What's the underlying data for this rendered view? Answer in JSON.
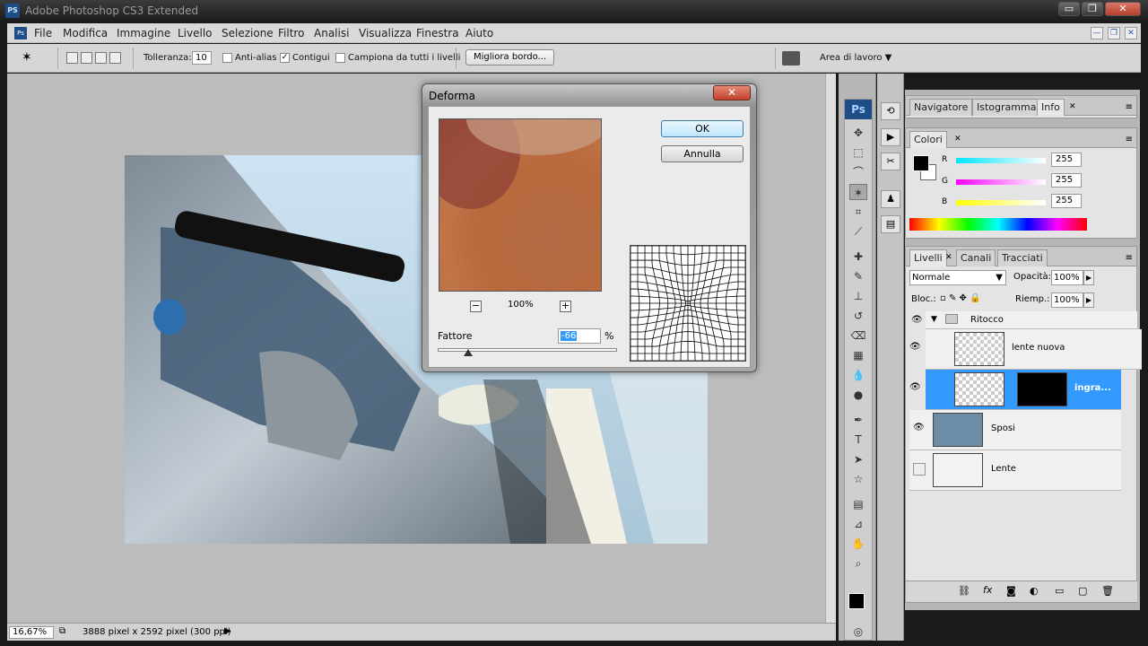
{
  "window": {
    "title": "Adobe Photoshop CS3 Extended",
    "app_badge": "Ps",
    "doc_badge": "PS",
    "window_controls": [
      "▭",
      "❐",
      "✕"
    ]
  },
  "menubar": {
    "items": [
      "File",
      "Modifica",
      "Immagine",
      "Livello",
      "Selezione",
      "Filtro",
      "Analisi",
      "Visualizza",
      "Finestra",
      "Aiuto"
    ],
    "doc_controls": [
      "—",
      "❐",
      "✕"
    ]
  },
  "optionsbar": {
    "tolerance_label": "Tolleranza:",
    "tolerance_value": "10",
    "antialias_label": "Anti-alias",
    "antialias_checked": false,
    "contiguous_label": "Contigui",
    "contiguous_checked": true,
    "sample_all_label": "Campiona da tutti i livelli",
    "sample_all_checked": false,
    "refine_edge_label": "Migliora bordo...",
    "workspace_label": "Area di lavoro ▼"
  },
  "statusbar": {
    "zoom": "16,67%",
    "doc_info": "3888 pixel x 2592 pixel (300 ppi)"
  },
  "dialog": {
    "title": "Deforma",
    "ok_label": "OK",
    "cancel_label": "Annulla",
    "zoom_pct": "100%",
    "zoom_out": "−",
    "zoom_in": "+",
    "factor_label": "Fattore",
    "factor_value": "-66",
    "factor_unit": "%",
    "factor_slider_position": 0.17
  },
  "panels": {
    "top_tabs": [
      "Navigatore",
      "Istogramma",
      "Info"
    ],
    "color_tab": "Colori",
    "color_channels": [
      {
        "label": "R",
        "value": "255",
        "gradient": "#00e5ff"
      },
      {
        "label": "G",
        "value": "255",
        "gradient": "#ff00ff"
      },
      {
        "label": "B",
        "value": "255",
        "gradient": "#ffff00"
      }
    ],
    "layer_tabs": [
      "Livelli",
      "Canali",
      "Tracciati"
    ],
    "blend_mode": "Normale",
    "opacity_label": "Opacità:",
    "opacity_value": "100%",
    "lock_label": "Bloc.:",
    "fill_label": "Riemp.:",
    "fill_value": "100%",
    "group_name": "Ritocco",
    "layers": [
      {
        "name": "lente nuova",
        "visible": true,
        "selected": false
      },
      {
        "name": "ingra...",
        "visible": true,
        "selected": true
      },
      {
        "name": "Sposi",
        "visible": true,
        "selected": false
      },
      {
        "name": "Lente",
        "visible": false,
        "selected": false
      }
    ]
  },
  "colors": {
    "selection_blue": "#3399ff",
    "ps_blue": "#1f4e87"
  }
}
